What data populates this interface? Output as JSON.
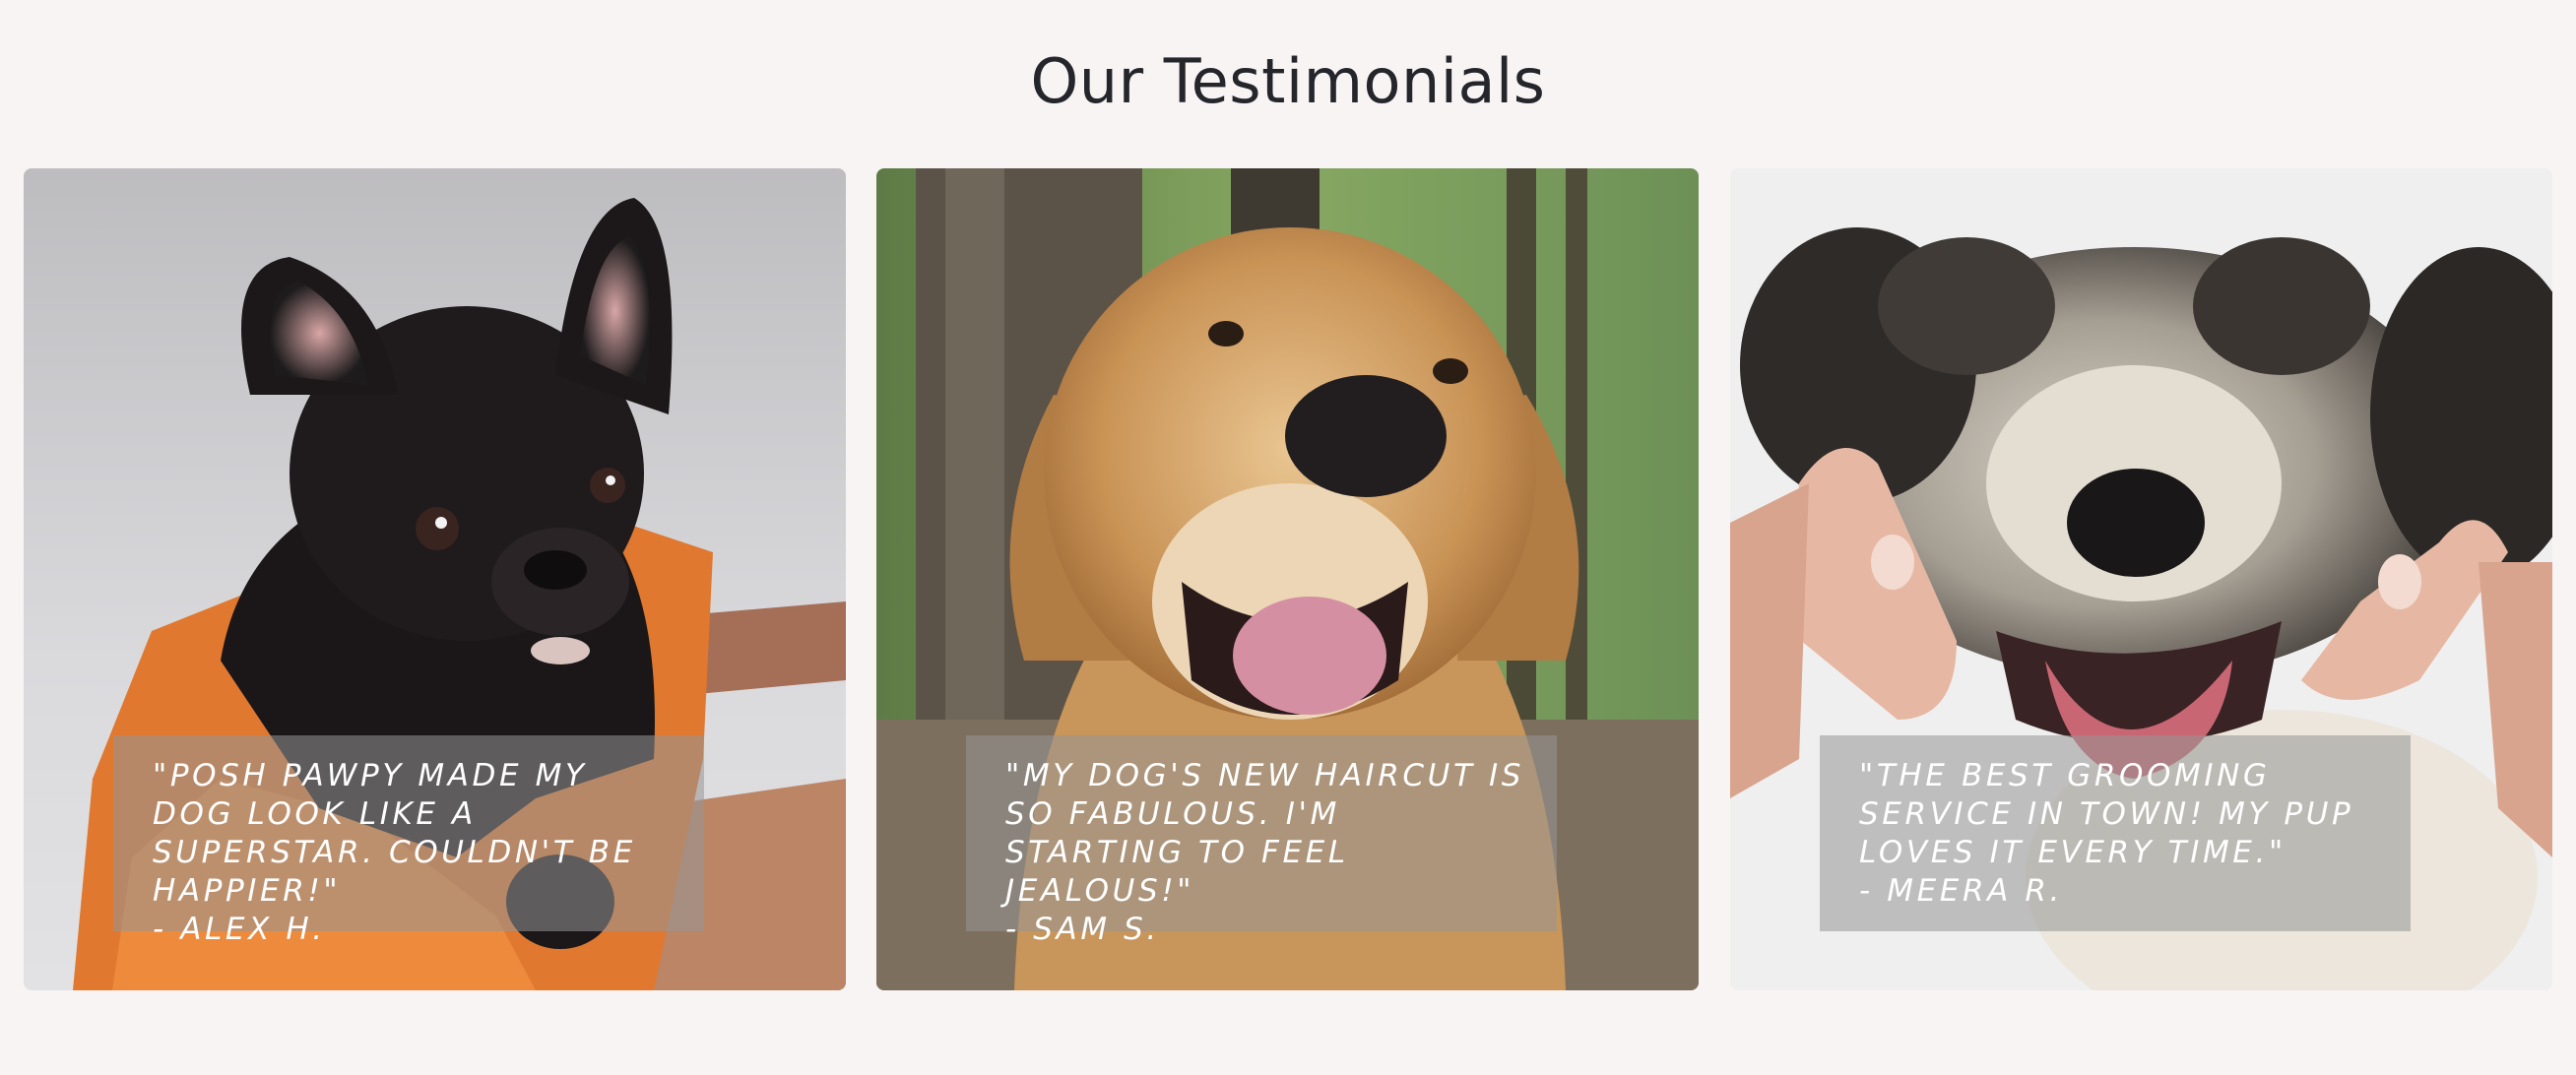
{
  "section": {
    "title": "Our Testimonials"
  },
  "testimonials": [
    {
      "quote": "\"Posh Pawpy made my dog look like a superstar. Couldn't be happier!\"",
      "author": "- Alex H.",
      "image": "french-bulldog-puppy-photo"
    },
    {
      "quote": "\"My dog's new haircut is so fabulous. I'm starting to feel jealous!\"",
      "author": "- Sam S.",
      "image": "golden-retriever-photo"
    },
    {
      "quote": "\"The best grooming service in town! My pup loves it every time.\"",
      "author": "- Meera R.",
      "image": "curly-poodle-mix-photo"
    }
  ],
  "colors": {
    "background": "#f9f4f4",
    "title": "#25262b",
    "quote_text": "#ffffff",
    "quote_overlay": "rgba(150,150,150,0.55)"
  }
}
